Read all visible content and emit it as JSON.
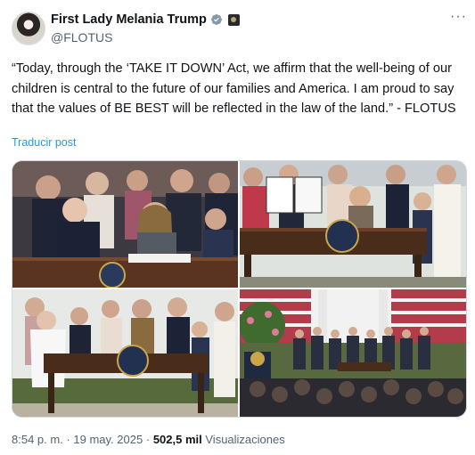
{
  "author": {
    "display_name": "First Lady Melania Trump",
    "handle": "@FLOTUS",
    "avatar_icon": "profile-photo",
    "verified_icon": "verified-badge-icon",
    "affiliation_icon": "government-badge-icon"
  },
  "more_button": "···",
  "tweet": {
    "text": "“Today, through the ‘TAKE IT DOWN’ Act, we affirm that the well-being of our children is central to the future of our families and America. I am proud to say that the values of BE BEST will be reflected in the law of the land.” - FLOTUS",
    "translate_label": "Traducir post"
  },
  "media": {
    "photos": [
      {
        "name": "photo-signing-at-desk"
      },
      {
        "name": "photo-holding-signed-act"
      },
      {
        "name": "photo-handshake-at-desk"
      },
      {
        "name": "photo-rose-garden-crowd"
      }
    ]
  },
  "meta": {
    "time": "8:54 p. m.",
    "separator": "·",
    "date": "19 may. 2025",
    "views_count": "502,5 mil",
    "views_label": "Visualizaciones"
  },
  "colors": {
    "accent": "#1d9bf0",
    "muted": "#536471",
    "text": "#0f1419"
  }
}
